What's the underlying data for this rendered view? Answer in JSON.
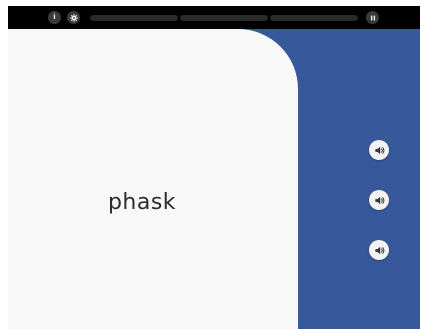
{
  "topbar": {
    "info_label": "i",
    "settings_icon": "gear-icon",
    "pause_icon": "pause-icon",
    "progress": [
      {
        "value": 0.0
      },
      {
        "value": 0.0
      },
      {
        "value": 0.0
      }
    ]
  },
  "card": {
    "word": "phask"
  },
  "audio_options": [
    {
      "icon": "speaker-icon"
    },
    {
      "icon": "speaker-icon"
    },
    {
      "icon": "speaker-icon"
    }
  ],
  "colors": {
    "panel": "#37589a",
    "card": "#f8f8f8",
    "topbar": "#000000"
  }
}
